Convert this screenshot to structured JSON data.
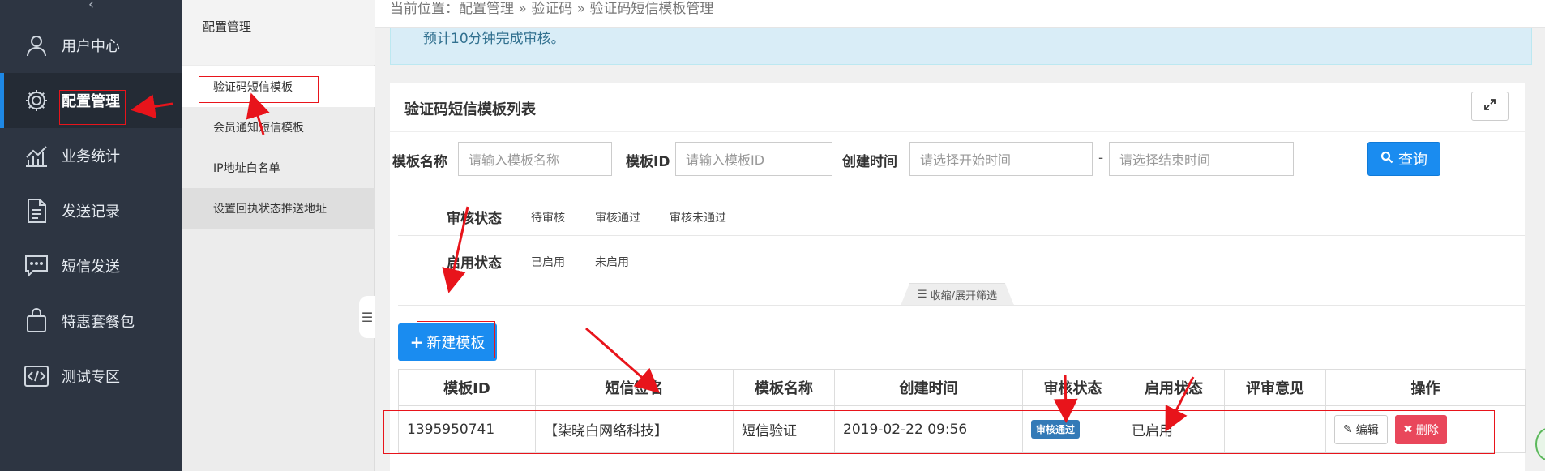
{
  "sidebar": {
    "collapse_glyph": "‹",
    "items": [
      {
        "label": "用户中心",
        "icon": "user-icon"
      },
      {
        "label": "配置管理",
        "icon": "gear-icon",
        "active": true
      },
      {
        "label": "业务统计",
        "icon": "chart-icon"
      },
      {
        "label": "发送记录",
        "icon": "document-icon"
      },
      {
        "label": "短信发送",
        "icon": "message-icon"
      },
      {
        "label": "特惠套餐包",
        "icon": "bag-icon"
      },
      {
        "label": "测试专区",
        "icon": "code-icon"
      }
    ]
  },
  "submenu": {
    "title": "配置管理",
    "items": [
      {
        "label": "验证码短信模板",
        "active": true
      },
      {
        "label": "会员通知短信模板"
      },
      {
        "label": "IP地址白名单"
      },
      {
        "label": "设置回执状态推送地址"
      }
    ]
  },
  "breadcrumb": "当前位置：配置管理 » 验证码 » 验证码短信模板管理",
  "notice": "预计10分钟完成审核。",
  "panel": {
    "title": "验证码短信模板列表",
    "filters": {
      "name_label": "模板名称",
      "name_placeholder": "请输入模板名称",
      "id_label": "模板ID",
      "id_placeholder": "请输入模板ID",
      "time_label": "创建时间",
      "start_placeholder": "请选择开始时间",
      "dash": "-",
      "end_placeholder": "请选择结束时间",
      "search_label": "查询"
    },
    "audit_status": {
      "label": "审核状态",
      "options": [
        "待审核",
        "审核通过",
        "审核未通过"
      ]
    },
    "enable_status": {
      "label": "启用状态",
      "options": [
        "已启用",
        "未启用"
      ]
    },
    "fold_label": "收缩/展开筛选",
    "new_button": "新建模板",
    "table": {
      "headers": [
        "模板ID",
        "短信签名",
        "模板名称",
        "创建时间",
        "审核状态",
        "启用状态",
        "评审意见",
        "操作"
      ],
      "rows": [
        {
          "id": "1395950741",
          "signature": "【柒晓白网络科技】",
          "name": "短信验证",
          "created": "2019-02-22 09:56",
          "audit": "审核通过",
          "enabled": "已启用",
          "review": "",
          "edit_label": "编辑",
          "delete_label": "删除"
        }
      ]
    }
  },
  "colors": {
    "sidebar_bg": "#2d3542",
    "primary": "#1a8cf0",
    "danger": "#e9475b",
    "annotation": "#e8141b",
    "notice_bg": "#d9edf7"
  }
}
